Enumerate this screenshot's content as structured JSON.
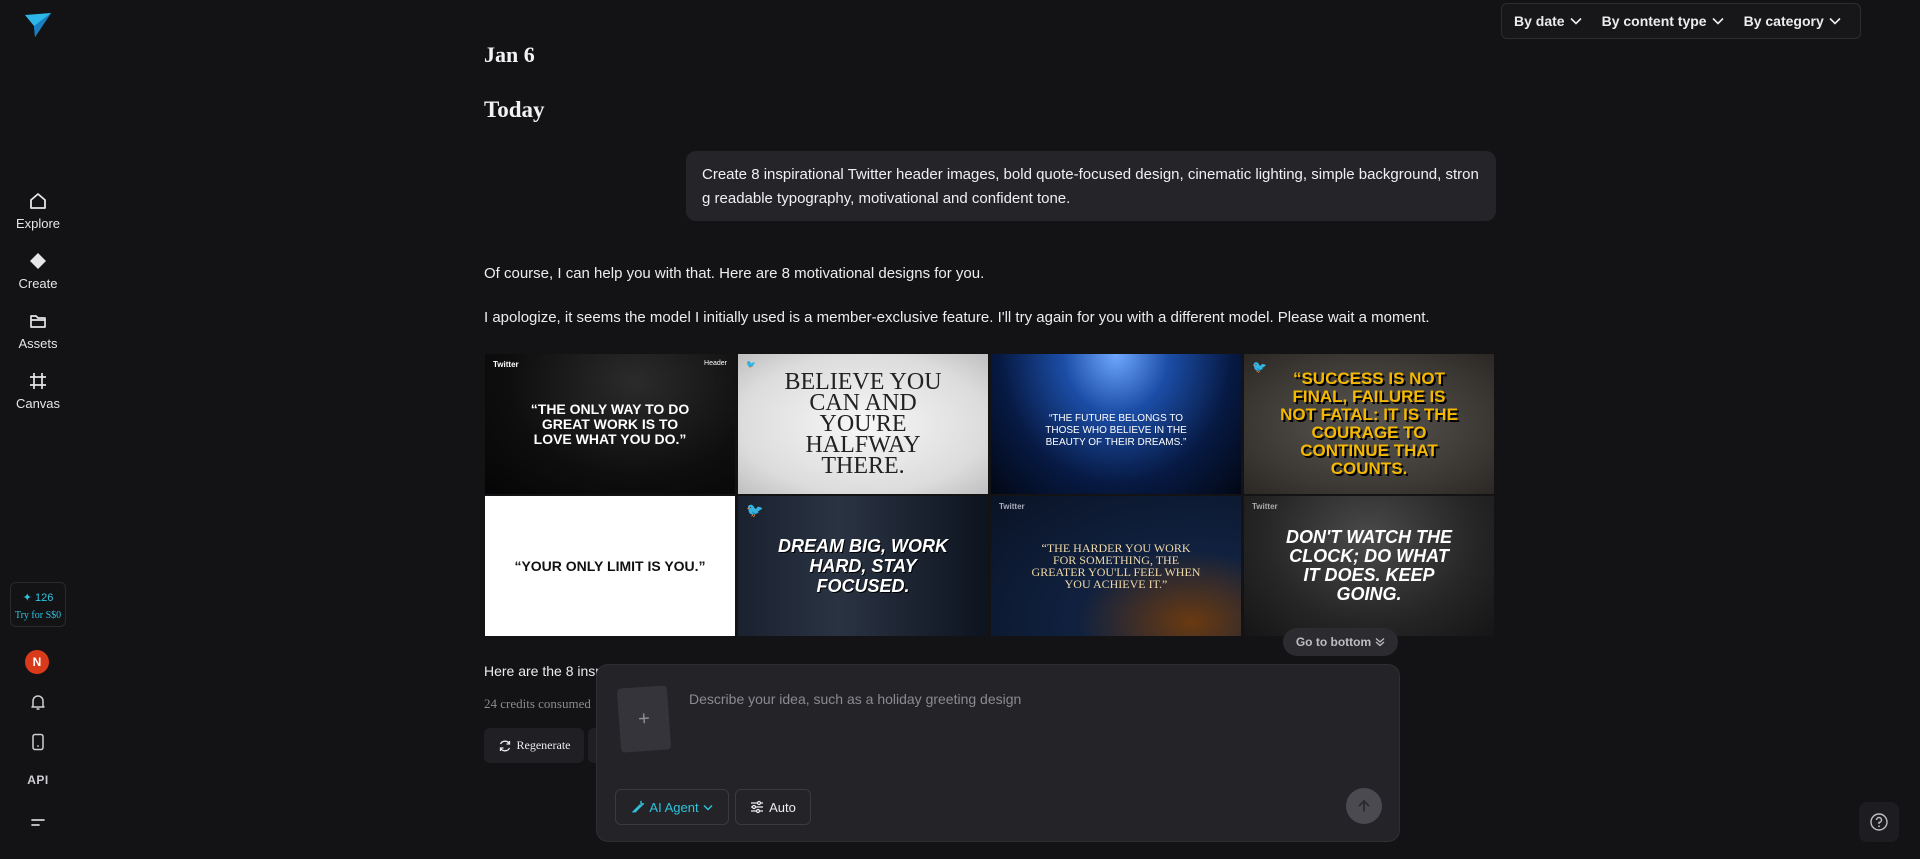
{
  "sidebar": {
    "items": [
      {
        "label": "Explore",
        "icon": "home-icon"
      },
      {
        "label": "Create",
        "icon": "diamond-icon"
      },
      {
        "label": "Assets",
        "icon": "folder-icon"
      },
      {
        "label": "Canvas",
        "icon": "canvas-icon"
      }
    ],
    "credits": {
      "count": "126",
      "cta": "Try for S$0"
    },
    "avatar_initial": "N",
    "api_label": "API"
  },
  "filters": {
    "by_date": "By date",
    "by_content_type": "By content type",
    "by_category": "By category"
  },
  "conversation": {
    "date_label": "Jan 6",
    "today_label": "Today",
    "user_prompt": "Create 8 inspirational Twitter header images, bold quote-focused design, cinematic lighting, simple background, strong readable typography, motivational and confident tone.",
    "ai_reply_1": "Of course, I can help you with that. Here are 8 motivational designs for you.",
    "ai_reply_2": "I apologize, it seems the model I initially used is a member-exclusive feature. I'll try again for you with a different model. Please wait a moment.",
    "images": [
      {
        "quote": "“THE ONLY WAY TO DO GREAT WORK IS TO LOVE WHAT YOU DO.”",
        "badge": "Twitter",
        "corner": "Header"
      },
      {
        "quote": "BELIEVE YOU CAN AND YOU'RE HALFWAY THERE."
      },
      {
        "quote": "“THE FUTURE BELONGS TO THOSE WHO BELIEVE IN THE BEAUTY OF THEIR DREAMS.”"
      },
      {
        "quote": "“SUCCESS IS NOT FINAL, FAILURE IS NOT FATAL: IT IS THE COURAGE TO CONTINUE THAT COUNTS."
      },
      {
        "quote": "“YOUR ONLY LIMIT IS YOU.”"
      },
      {
        "quote": "DREAM BIG, WORK HARD, STAY FOCUSED."
      },
      {
        "quote": "“THE HARDER YOU WORK FOR SOMETHING, THE GREATER YOU'LL FEEL WHEN YOU ACHIEVE IT.”",
        "badge": "Twitter"
      },
      {
        "quote": "DON'T WATCH THE CLOCK; DO WHAT IT DOES. KEEP GOING.",
        "badge": "Twitter"
      }
    ],
    "go_to_bottom": "Go to bottom",
    "summary_partial": "Here are the 8 inspi",
    "credits_consumed": "24 credits consumed",
    "regenerate": "Regenerate"
  },
  "composer": {
    "placeholder": "Describe your idea, such as a holiday greeting design",
    "value": "",
    "agent_label": "AI Agent",
    "auto_label": "Auto"
  },
  "colors": {
    "background": "#131315",
    "accent": "#2fc3dc",
    "avatar": "#d93a1a"
  }
}
